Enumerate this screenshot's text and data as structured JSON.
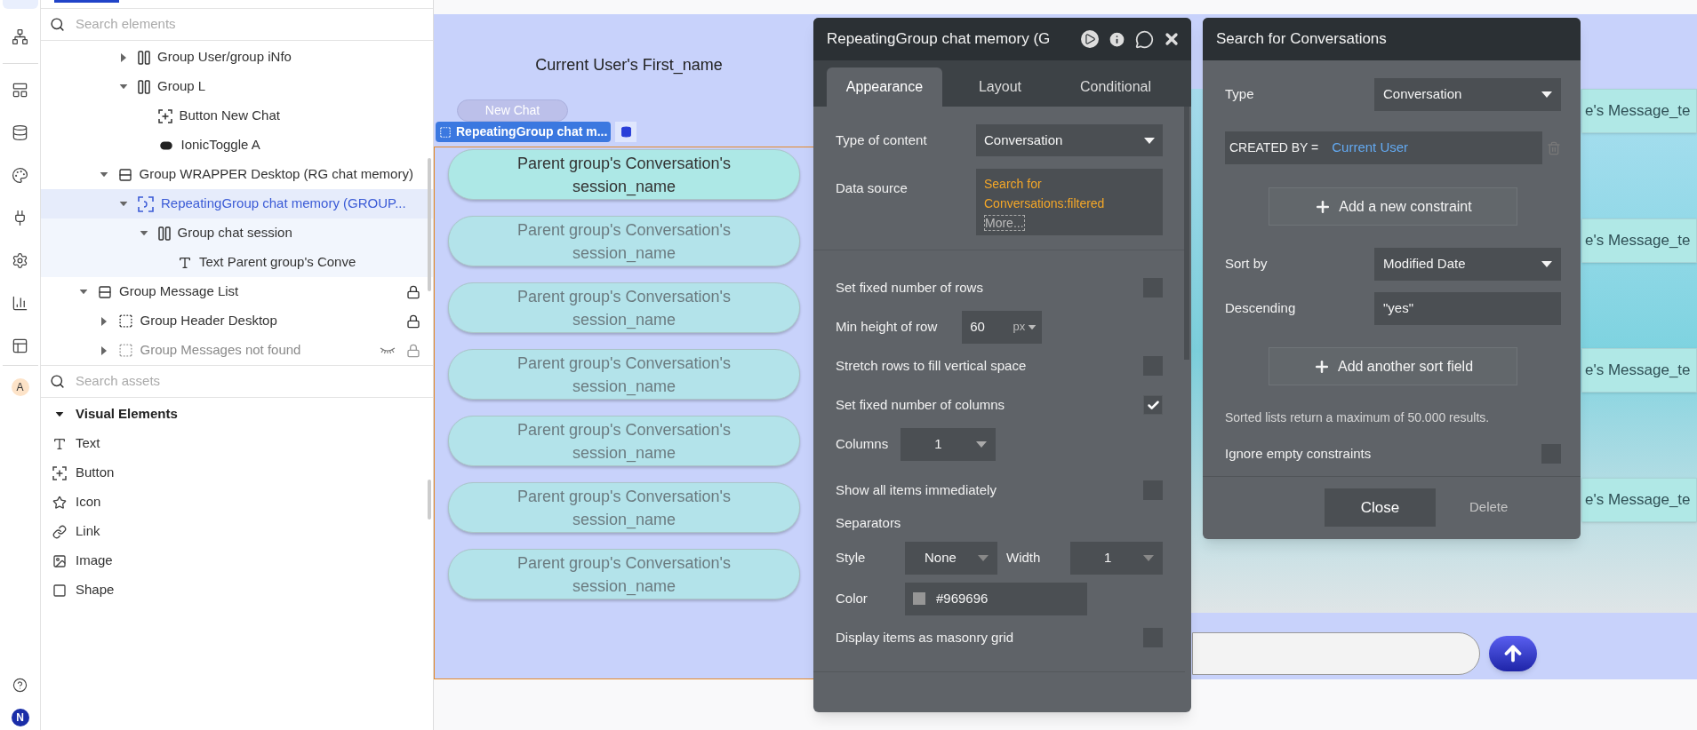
{
  "rail": {
    "user_badge": "A",
    "account_badge": "N"
  },
  "element_search": {
    "placeholder": "Search elements"
  },
  "tree": {
    "items": [
      {
        "children": [
          {
            "children": [
              {
                "label": "Group User/group iNfo",
                "kind": "columns",
                "expandable": true,
                "expanded": false,
                "selected": false,
                "locked": false,
                "hidden": false
              },
              {
                "label": "Group L",
                "kind": "columns",
                "expandable": true,
                "expanded": true,
                "selected": false,
                "locked": false,
                "hidden": false,
                "children": [
                  {
                    "label": "Button New Chat",
                    "kind": "button",
                    "expandable": false,
                    "expanded": false,
                    "selected": false,
                    "locked": false,
                    "hidden": false
                  },
                  {
                    "label": "IonicToggle A",
                    "kind": "toggle",
                    "expandable": false,
                    "expanded": false,
                    "selected": false,
                    "locked": false,
                    "hidden": false
                  }
                ]
              }
            ]
          },
          {
            "label": "Group WRAPPER Desktop (RG chat memory)",
            "kind": "rows",
            "expandable": true,
            "expanded": true,
            "selected": false,
            "locked": false,
            "hidden": false,
            "children": [
              {
                "label": "RepeatingGroup chat memory (GROUP...",
                "kind": "repeating",
                "expandable": true,
                "expanded": true,
                "selected": true,
                "locked": false,
                "hidden": false,
                "children": [
                  {
                    "label": "Group chat session",
                    "kind": "columns",
                    "expandable": true,
                    "expanded": true,
                    "selected": false,
                    "locked": false,
                    "hidden": false,
                    "children": [
                      {
                        "label": "Text Parent group's Conve",
                        "kind": "text",
                        "expandable": false,
                        "expanded": false,
                        "selected": false,
                        "locked": false,
                        "hidden": false
                      }
                    ]
                  }
                ]
              }
            ]
          }
        ]
      },
      {
        "label": "Group Message List",
        "kind": "rows",
        "expandable": true,
        "expanded": true,
        "selected": false,
        "locked": true,
        "hidden": false,
        "children": [
          {
            "label": "Group Header Desktop",
            "kind": "group",
            "expandable": true,
            "expanded": false,
            "selected": false,
            "locked": true,
            "hidden": false
          },
          {
            "label": "Group Messages not found",
            "kind": "group",
            "expandable": true,
            "expanded": false,
            "selected": false,
            "locked": true,
            "hidden": true
          }
        ]
      }
    ]
  },
  "asset_search": {
    "placeholder": "Search assets"
  },
  "assets": {
    "section": "Visual Elements",
    "expanded": true,
    "items": [
      {
        "label": "Text",
        "kind": "text"
      },
      {
        "label": "Button",
        "kind": "button"
      },
      {
        "label": "Icon",
        "kind": "icon"
      },
      {
        "label": "Link",
        "kind": "link"
      },
      {
        "label": "Image",
        "kind": "image"
      },
      {
        "label": "Shape",
        "kind": "shape"
      }
    ]
  },
  "canvas": {
    "header_title": "Current User's First_name",
    "new_chat_button": "New Chat",
    "selection_tag": "RepeatingGroup chat m...",
    "session_cells": [
      {
        "text": "Parent group's Conversation's session_name",
        "active": true
      },
      {
        "text": "Parent group's Conversation's session_name",
        "active": false
      },
      {
        "text": "Parent group's Conversation's session_name",
        "active": false
      },
      {
        "text": "Parent group's Conversation's session_name",
        "active": false
      },
      {
        "text": "Parent group's Conversation's session_name",
        "active": false
      },
      {
        "text": "Parent group's Conversation's session_name",
        "active": false
      },
      {
        "text": "Parent group's Conversation's session_name",
        "active": false
      }
    ],
    "message_bubbles": [
      "e's Message_te",
      "e's Message_te",
      "e's Message_te",
      "e's Message_te"
    ]
  },
  "property_editor": {
    "title": "RepeatingGroup chat memory (G",
    "tabs": [
      {
        "label": "Appearance",
        "selected": true
      },
      {
        "label": "Layout",
        "selected": false
      },
      {
        "label": "Conditional",
        "selected": false
      }
    ],
    "fields": [
      {
        "kind": "dropdown",
        "label": "Type of content",
        "value": "Conversation"
      },
      {
        "kind": "expression",
        "label": "Data source",
        "value": "Search for Conversations:filtered",
        "more": "More..."
      },
      {
        "kind": "divider"
      },
      {
        "kind": "checkbox",
        "label": "Set fixed number of rows",
        "checked": false
      },
      {
        "kind": "number",
        "label": "Min height of row",
        "value": "60",
        "unit": "px"
      },
      {
        "kind": "checkbox",
        "label": "Stretch rows to fill vertical space",
        "checked": false
      },
      {
        "kind": "checkbox",
        "label": "Set fixed number of columns",
        "checked": true
      },
      {
        "kind": "small_dropdown",
        "label": "Columns",
        "value": "1"
      },
      {
        "kind": "checkbox",
        "label": "Show all items immediately",
        "checked": false
      },
      {
        "kind": "heading",
        "label": "Separators"
      },
      {
        "kind": "dual_dropdown",
        "label": "Style",
        "value": "None",
        "label_2": "Width",
        "value_2": "1"
      },
      {
        "kind": "color",
        "label": "Color",
        "value": "#969696",
        "color": "#969696"
      },
      {
        "kind": "checkbox",
        "label": "Display items as masonry grid",
        "checked": false
      },
      {
        "kind": "divider"
      }
    ]
  },
  "search_editor": {
    "title": "Search for Conversations",
    "type": {
      "label": "Type",
      "value": "Conversation"
    },
    "constraints": [
      {
        "field": "CREATED BY =",
        "value": "Current User"
      }
    ],
    "add_constraint": "Add a new constraint",
    "sort_by": {
      "label": "Sort by",
      "value": "Modified Date"
    },
    "descending": {
      "label": "Descending",
      "value": "\"yes\""
    },
    "add_sort": "Add another sort field",
    "note": "Sorted lists return a maximum of 50.000 results.",
    "ignore_empty": {
      "label": "Ignore empty constraints",
      "checked": false
    },
    "close_button": "Close",
    "delete_button": "Delete"
  }
}
